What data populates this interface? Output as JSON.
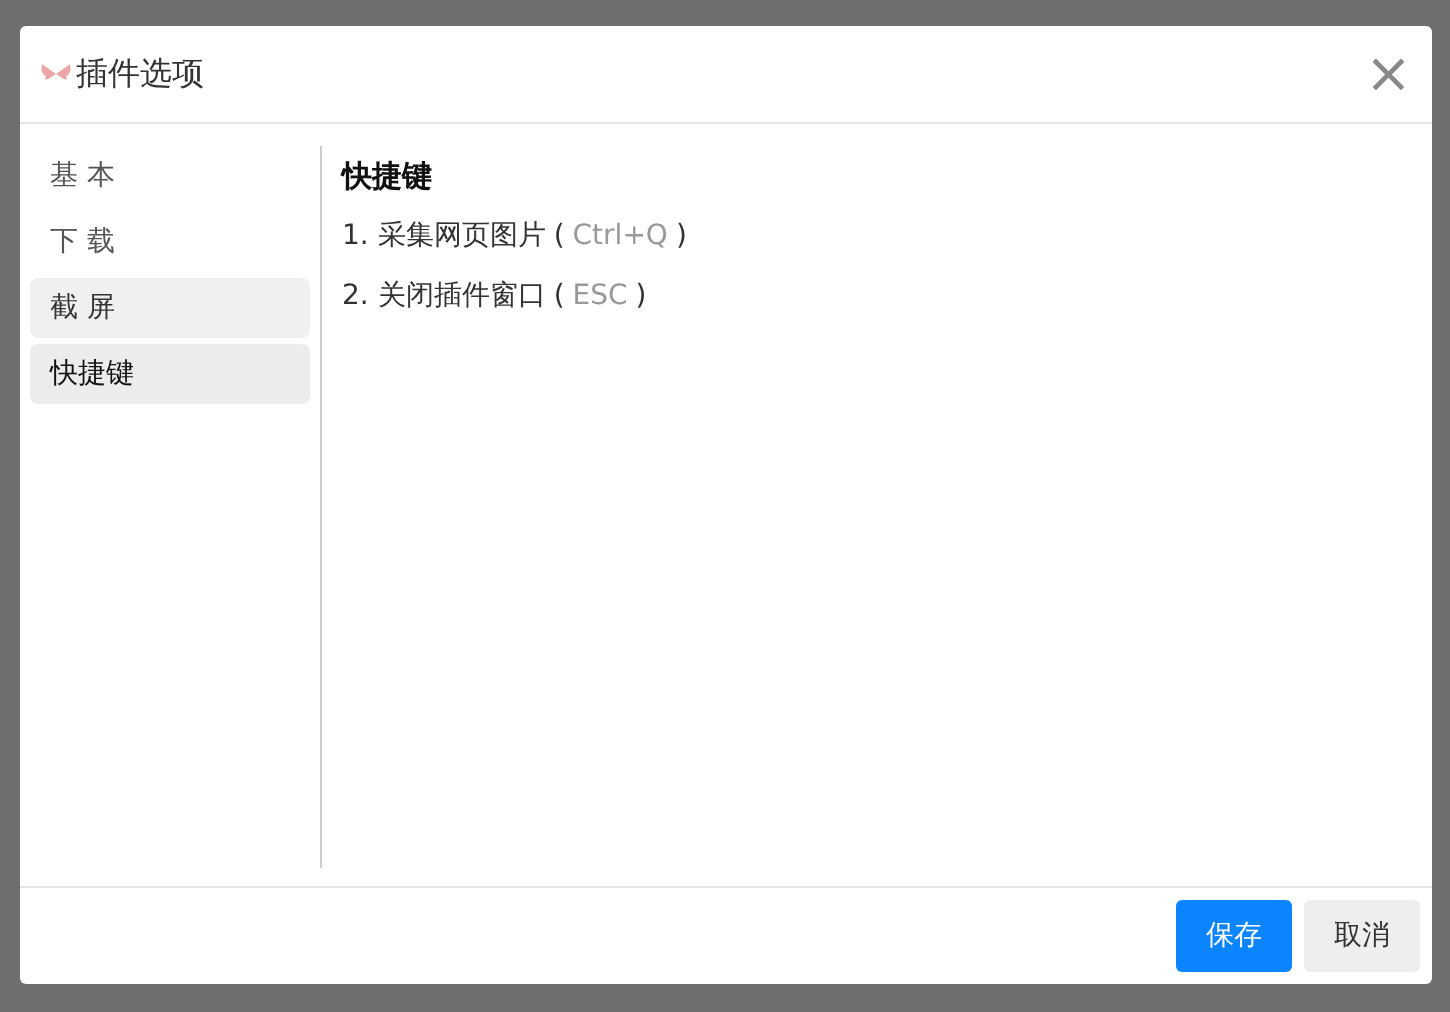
{
  "dialog": {
    "title": "插件选项",
    "close": "×"
  },
  "sidebar": {
    "items": [
      {
        "label": "基 本",
        "selected": false,
        "hovered": false
      },
      {
        "label": "下 载",
        "selected": false,
        "hovered": false
      },
      {
        "label": "截 屏",
        "selected": false,
        "hovered": true
      },
      {
        "label": "快捷键",
        "selected": true,
        "hovered": false
      }
    ]
  },
  "content": {
    "heading": "快捷键",
    "shortcuts": [
      {
        "action": "1. 采集网页图片",
        "open": "(",
        "key": "Ctrl+Q",
        "close": ")"
      },
      {
        "action": "2. 关闭插件窗口",
        "open": "(",
        "key": "ESC",
        "close": ")"
      }
    ]
  },
  "buttons": [
    {
      "label": "保存",
      "kind": "primary"
    },
    {
      "label": "取消",
      "kind": "secondary"
    }
  ]
}
